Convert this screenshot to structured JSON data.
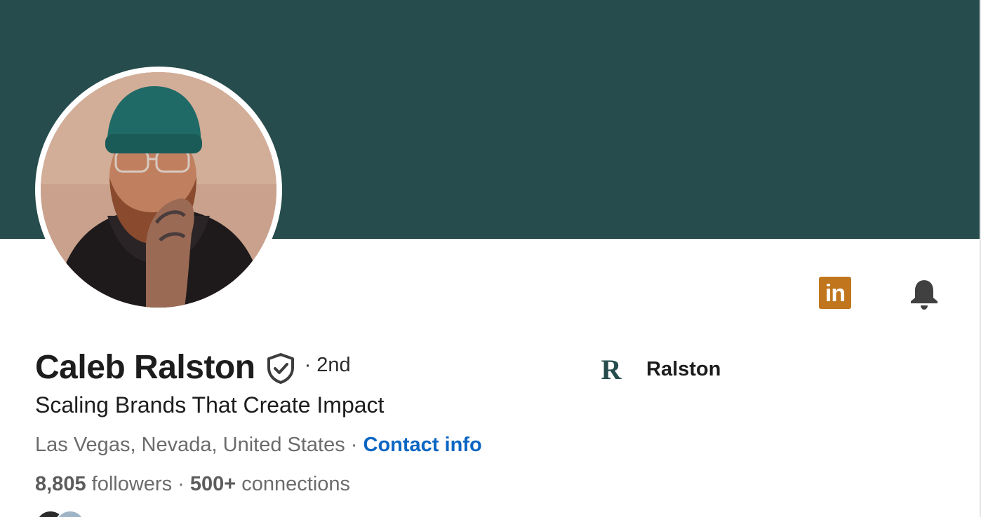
{
  "profile": {
    "name": "Caleb Ralston",
    "connection_degree": "· 2nd",
    "headline": "Scaling Brands That Create Impact",
    "location": "Las Vegas, Nevada, United States",
    "separator": " · ",
    "contact_info_label": "Contact info",
    "followers_count": "8,805",
    "followers_label": " followers",
    "stats_separator": "  · ",
    "connections_count": "500+",
    "connections_label": " connections"
  },
  "current_company": {
    "logo_letter": "R",
    "name": "Ralston"
  },
  "icons": {
    "linkedin_badge": "in",
    "verified": "shield-check-icon",
    "notify": "bell-icon"
  },
  "colors": {
    "banner": "#264c4d",
    "linkedin_badge": "#c1761e",
    "link": "#0a66c2",
    "company_logo": "#264c4d"
  }
}
